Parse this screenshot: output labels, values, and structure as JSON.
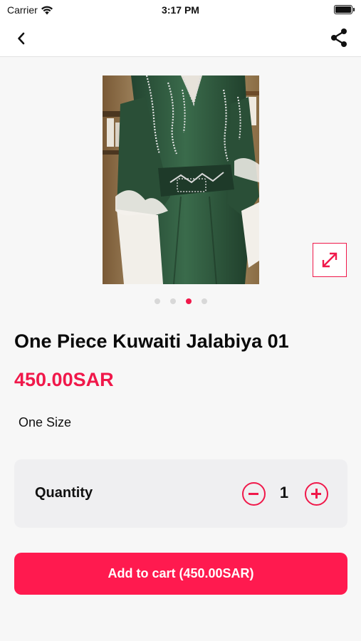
{
  "status_bar": {
    "carrier": "Carrier",
    "time": "3:17 PM"
  },
  "nav": {
    "back_icon": "chevron-left-icon",
    "share_icon": "share-icon"
  },
  "gallery": {
    "image_count": 4,
    "active_index": 2,
    "expand_icon": "expand-icon"
  },
  "product": {
    "title": "One Piece Kuwaiti Jalabiya 01",
    "price": "450.00SAR",
    "size": "One Size"
  },
  "quantity": {
    "label": "Quantity",
    "value": "1"
  },
  "cart": {
    "button_label": "Add to cart (450.00SAR)"
  },
  "colors": {
    "accent": "#f0184a",
    "button": "#ff1a4f",
    "dress": "#2f5a3e"
  }
}
